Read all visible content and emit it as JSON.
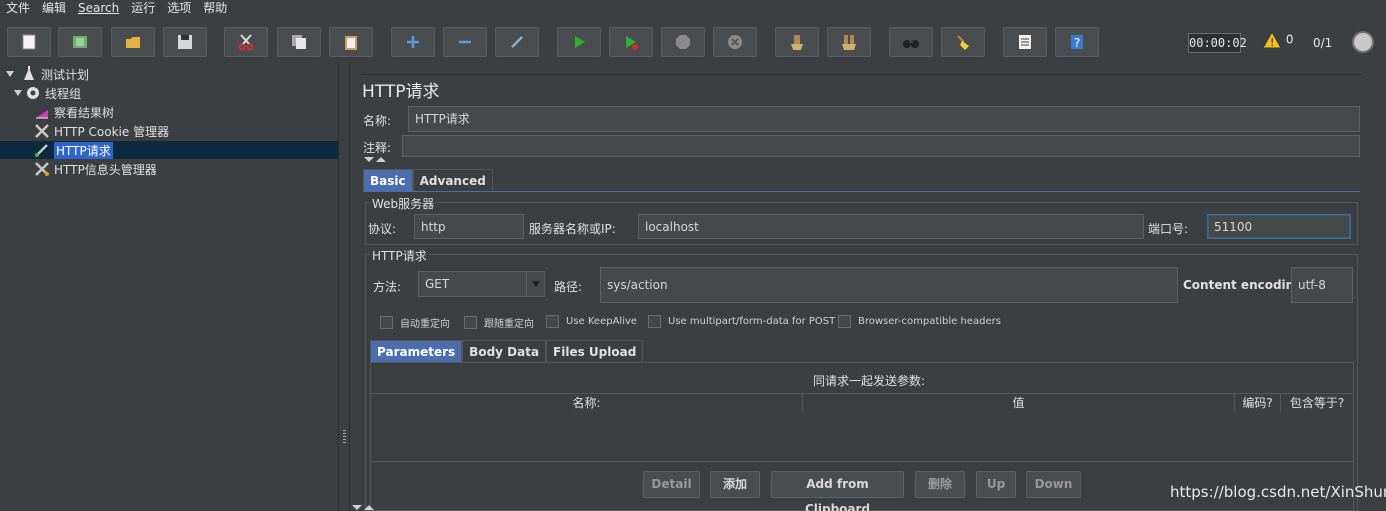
{
  "menu": {
    "items": [
      "文件",
      "编辑",
      "Search",
      "运行",
      "选项",
      "帮助"
    ]
  },
  "toolbar": {
    "buttons": [
      {
        "name": "new-icon",
        "color": "#f0f0f0"
      },
      {
        "name": "templates-icon",
        "color": "#5ab05a"
      },
      {
        "name": "open-icon",
        "color": "#e8b040"
      },
      {
        "name": "save-icon",
        "color": "#d0d0d0"
      },
      {
        "name": "cut-icon",
        "color": "#d04040"
      },
      {
        "name": "copy-icon",
        "color": "#d0d0d0"
      },
      {
        "name": "paste-icon",
        "color": "#e0c080"
      },
      {
        "name": "expand-icon",
        "color": "#5a9ae0"
      },
      {
        "name": "collapse-icon",
        "color": "#5a9ae0"
      },
      {
        "name": "toggle-icon",
        "color": "#8ab0d0"
      },
      {
        "name": "start-icon",
        "color": "#30b030"
      },
      {
        "name": "start-no-pauses-icon",
        "color": "#30b030"
      },
      {
        "name": "stop-icon",
        "color": "#8a8a8a"
      },
      {
        "name": "shutdown-icon",
        "color": "#8a8a8a"
      },
      {
        "name": "clear-icon",
        "color": "#c0a060"
      },
      {
        "name": "clear-all-icon",
        "color": "#c0a060"
      },
      {
        "name": "search-icon",
        "color": "#404040"
      },
      {
        "name": "reset-search-icon",
        "color": "#e0c040"
      },
      {
        "name": "function-helper-icon",
        "color": "#e0e0e0"
      },
      {
        "name": "help-icon",
        "color": "#4a8ae0"
      }
    ],
    "timer": "00:00:02",
    "warnings": "0",
    "threads": "0/1"
  },
  "tree": {
    "items": [
      {
        "label": "测试计划",
        "name": "tree-item-test-plan"
      },
      {
        "label": "线程组",
        "name": "tree-item-thread-group"
      },
      {
        "label": "察看结果树",
        "name": "tree-item-results-tree"
      },
      {
        "label": "HTTP Cookie 管理器",
        "name": "tree-item-cookie-manager"
      },
      {
        "label": "HTTP请求",
        "name": "tree-item-http-request"
      },
      {
        "label": "HTTP信息头管理器",
        "name": "tree-item-header-manager"
      }
    ]
  },
  "panel": {
    "title": "HTTP请求",
    "name_label": "名称:",
    "name_value": "HTTP请求",
    "comment_label": "注释:",
    "comment_value": "",
    "tabs": [
      "Basic",
      "Advanced"
    ],
    "web_server": {
      "title": "Web服务器",
      "protocol_label": "协议:",
      "protocol_value": "http",
      "server_label": "服务器名称或IP:",
      "server_value": "localhost",
      "port_label": "端口号:",
      "port_value": "51100"
    },
    "http_request": {
      "title": "HTTP请求",
      "method_label": "方法:",
      "method_value": "GET",
      "path_label": "路径:",
      "path_value": "sys/action",
      "encoding_label": "Content encoding:",
      "encoding_value": "utf-8"
    },
    "checkboxes": [
      "自动重定向",
      "跟随重定向",
      "Use KeepAlive",
      "Use multipart/form-data for POST",
      "Browser-compatible headers"
    ],
    "sub_tabs": [
      "Parameters",
      "Body Data",
      "Files Upload"
    ],
    "params": {
      "caption": "同请求一起发送参数:",
      "columns": [
        "名称:",
        "值",
        "编码?",
        "包含等于?"
      ]
    },
    "buttons": [
      "Detail",
      "添加",
      "Add from Clipboard",
      "删除",
      "Up",
      "Down"
    ]
  },
  "watermark": "https://blog.csdn.net/XinShun"
}
